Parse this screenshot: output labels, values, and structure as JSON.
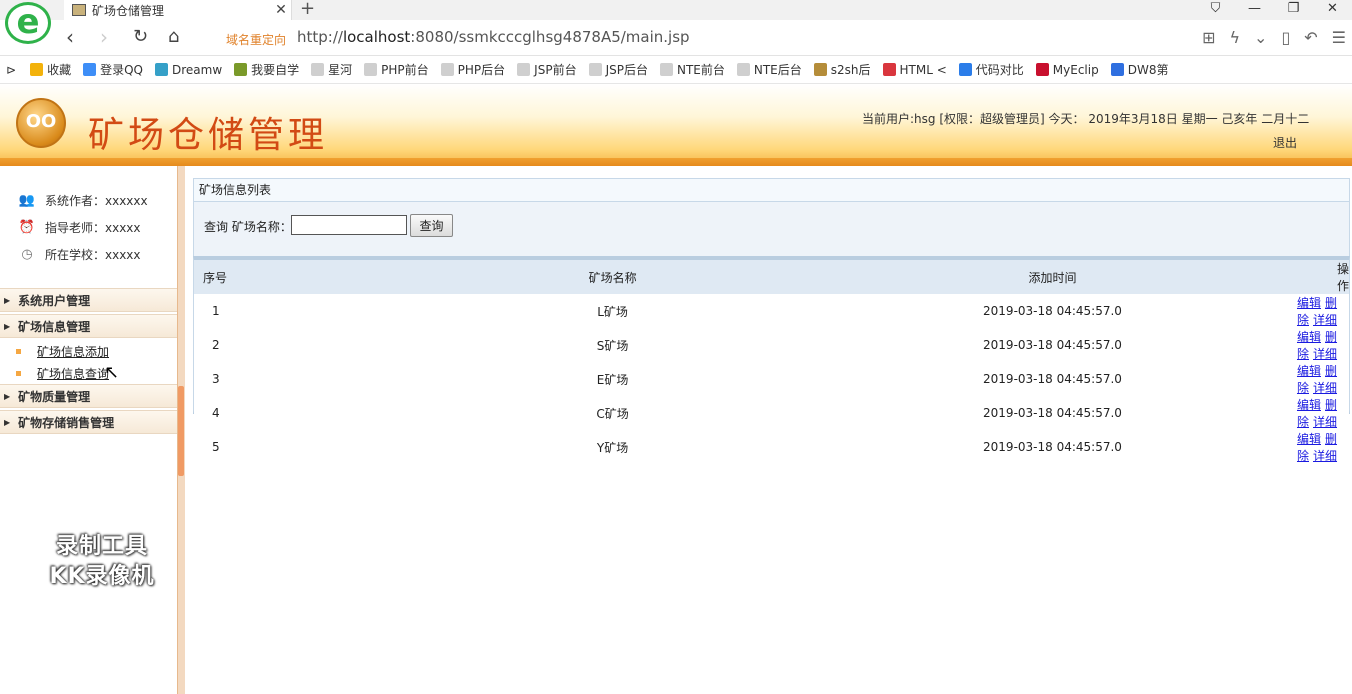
{
  "browser": {
    "tab_title": "矿场仓储管理",
    "redirect_label": "域名重定向",
    "url_prefix": "http://",
    "url_host": "localhost",
    "url_rest": ":8080/ssmkcccglhsg4878A5/main.jsp",
    "bookmarks": [
      {
        "label": "收藏",
        "icon": "star-icon",
        "color": "#f3b20b"
      },
      {
        "label": "登录QQ",
        "icon": "qq-icon",
        "color": "#3e8ef7"
      },
      {
        "label": "Dreamw",
        "icon": "dreamweaver-icon",
        "color": "#35a0c8"
      },
      {
        "label": "我要自学",
        "icon": "study-icon",
        "color": "#7a9a2a"
      },
      {
        "label": "星河",
        "icon": "page-icon",
        "color": "#cfcfcf"
      },
      {
        "label": "PHP前台",
        "icon": "page-icon",
        "color": "#cfcfcf"
      },
      {
        "label": "PHP后台",
        "icon": "page-icon",
        "color": "#cfcfcf"
      },
      {
        "label": "JSP前台",
        "icon": "page-icon",
        "color": "#cfcfcf"
      },
      {
        "label": "JSP后台",
        "icon": "page-icon",
        "color": "#cfcfcf"
      },
      {
        "label": "NTE前台",
        "icon": "page-icon",
        "color": "#cfcfcf"
      },
      {
        "label": "NTE后台",
        "icon": "page-icon",
        "color": "#cfcfcf"
      },
      {
        "label": "s2sh后",
        "icon": "image-icon",
        "color": "#b58d3a"
      },
      {
        "label": "HTML <",
        "icon": "html-icon",
        "color": "#d9363e"
      },
      {
        "label": "代码对比",
        "icon": "compare-icon",
        "color": "#2b7de9"
      },
      {
        "label": "MyEclip",
        "icon": "myeclipse-icon",
        "color": "#c8102e"
      },
      {
        "label": "DW8第",
        "icon": "paw-icon",
        "color": "#2f6fe0"
      }
    ]
  },
  "header": {
    "logo_text": "OO",
    "title": "矿场仓储管理",
    "user_info": "当前用户:hsg [权限：超级管理员] 今天： 2019年3月18日 星期一 己亥年 二月十二",
    "logout": "退出"
  },
  "sidebar": {
    "info": [
      {
        "label": "系统作者：xxxxxx",
        "icon": "author-icon"
      },
      {
        "label": "指导老师：xxxxx",
        "icon": "teacher-icon"
      },
      {
        "label": "所在学校：xxxxx",
        "icon": "school-icon"
      }
    ],
    "menu": {
      "system_users": "系统用户管理",
      "mine_info": "矿场信息管理",
      "mine_info_add": "矿场信息添加",
      "mine_info_query": "矿场信息查询",
      "mineral_quality": "矿物质量管理",
      "mineral_storage": "矿物存储销售管理"
    },
    "watermark_line1": "录制工具",
    "watermark_line2": "KK录像机"
  },
  "main": {
    "panel_title": "矿场信息列表",
    "search_label": "查询 矿场名称：",
    "search_value": "",
    "search_button": "查询",
    "columns": [
      "序号",
      "矿场名称",
      "添加时间",
      "操作"
    ],
    "rows": [
      {
        "no": "1",
        "name": "L矿场",
        "time": "2019-03-18 04:45:57.0"
      },
      {
        "no": "2",
        "name": "S矿场",
        "time": "2019-03-18 04:45:57.0"
      },
      {
        "no": "3",
        "name": "E矿场",
        "time": "2019-03-18 04:45:57.0"
      },
      {
        "no": "4",
        "name": "C矿场",
        "time": "2019-03-18 04:45:57.0"
      },
      {
        "no": "5",
        "name": "Y矿场",
        "time": "2019-03-18 04:45:57.0"
      }
    ],
    "ops": {
      "edit": "编辑",
      "delete": "删除",
      "detail": "详细"
    }
  }
}
